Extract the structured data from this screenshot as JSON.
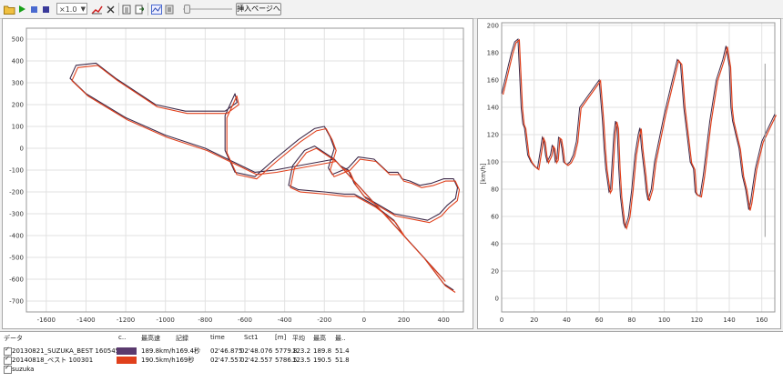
{
  "colors": {
    "run1": "#3c2848",
    "run2": "#e0401c"
  },
  "toolbar": {
    "icons": [
      "open-folder-icon",
      "play-icon",
      "pause-icon",
      "stop-icon",
      "chart-edit-icon",
      "close-icon",
      "clipboard-icon",
      "export-icon",
      "line-chart-icon",
      "stats-icon"
    ],
    "zoom": "×1.0",
    "insert_label": "挿入ページへ"
  },
  "map": {
    "x_ticks": [
      "-1600",
      "-1400",
      "-1200",
      "-1000",
      "-800",
      "-600",
      "-400",
      "-200",
      "0",
      "200",
      "400"
    ],
    "y_ticks": [
      "500",
      "400",
      "300",
      "200",
      "100",
      "0",
      "-100",
      "-200",
      "-300",
      "-400",
      "-500",
      "-600",
      "-700"
    ]
  },
  "speed": {
    "y_label": "[km/h]",
    "y_ticks": [
      "200",
      "180",
      "160",
      "140",
      "120",
      "100",
      "80",
      "60",
      "40",
      "20",
      "0"
    ],
    "x_ticks": [
      "0",
      "20",
      "40",
      "60",
      "80",
      "100",
      "120",
      "140",
      "160"
    ]
  },
  "table": {
    "headers": [
      "データ",
      "c..",
      "最高速",
      "記録",
      "time",
      "Sct1",
      "[m]",
      "平均",
      "最高",
      "最.."
    ],
    "rows": [
      {
        "name": "20130821_SUZUKA_BEST 160545",
        "max_speed": "189.8km/h",
        "record": "169.4秒",
        "time": "02'46.875",
        "sct1": "02'48.076",
        "m": "5779.8",
        "avg": "123.2",
        "max": "189.8",
        "min": "51.4",
        "has_color": true,
        "color": "#5a3a6e"
      },
      {
        "name": "20140818_ベスト 100301",
        "max_speed": "190.5km/h",
        "record": "169秒",
        "time": "02'47.557",
        "sct1": "02'42.557",
        "m": "5786.5",
        "avg": "123.5",
        "max": "190.5",
        "min": "51.8",
        "has_color": true,
        "color": "#e0401c"
      },
      {
        "name": "suzuka",
        "max_speed": "",
        "record": "",
        "time": "",
        "sct1": "",
        "m": "",
        "avg": "",
        "max": "",
        "min": "",
        "has_color": false,
        "color": ""
      }
    ]
  },
  "chart_data": [
    {
      "type": "line",
      "title": "",
      "xlabel": "",
      "ylabel": "",
      "xlim": [
        -1700,
        500
      ],
      "ylim": [
        -750,
        550
      ],
      "grid": true,
      "series": [
        {
          "x": [
            400,
            -150,
            -450,
            -550,
            -800,
            -1000,
            -1200,
            -1400,
            -1480,
            -1450,
            -1350,
            -1250,
            -1050,
            -900,
            -700,
            -640,
            -650,
            -700,
            -700,
            -650,
            -550,
            -450,
            -330,
            -250,
            -200,
            -170,
            -150,
            -180,
            -160,
            -80,
            -30,
            50,
            120,
            170,
            190,
            230,
            280,
            340,
            400,
            450,
            470,
            460,
            420,
            380,
            320,
            150,
            0,
            -50,
            -80,
            -120,
            -150,
            -250,
            -300,
            -360,
            -380,
            -330,
            -200,
            -100,
            -50,
            50,
            150,
            200,
            250,
            300,
            350,
            400,
            450
          ],
          "y": [
            -600,
            -50,
            -100,
            -110,
            0,
            60,
            140,
            250,
            320,
            380,
            390,
            320,
            200,
            170,
            170,
            210,
            250,
            150,
            -10,
            -110,
            -130,
            -50,
            40,
            90,
            100,
            50,
            0,
            -90,
            -120,
            -90,
            -40,
            -50,
            -110,
            -110,
            -140,
            -150,
            -170,
            -160,
            -140,
            -140,
            -180,
            -230,
            -260,
            -300,
            -330,
            -300,
            -220,
            -160,
            -100,
            -80,
            -50,
            10,
            -10,
            -80,
            -170,
            -190,
            -200,
            -210,
            -210,
            -260,
            -330,
            -400,
            -450,
            -500,
            -560,
            -620,
            -650
          ]
        }
      ]
    },
    {
      "type": "line",
      "title": "",
      "xlabel": "",
      "ylabel": "[km/h]",
      "xlim": [
        0,
        168
      ],
      "ylim": [
        -10,
        202
      ],
      "grid": true,
      "series": [
        {
          "values": [
            150,
            160,
            170,
            180,
            188,
            190,
            140,
            128,
            125,
            105,
            100,
            97,
            95,
            110,
            118,
            115,
            105,
            100,
            105,
            112,
            110,
            100,
            102,
            118,
            117,
            110,
            100,
            98,
            100,
            105,
            115,
            140,
            160,
            130,
            110,
            95,
            78,
            80,
            100,
            120,
            130,
            125,
            95,
            75,
            65,
            55,
            52,
            60,
            80,
            105,
            120,
            125,
            110,
            90,
            78,
            72,
            80,
            100,
            135,
            155,
            165,
            175,
            172,
            140,
            120,
            100,
            95,
            78,
            76,
            75,
            90,
            110,
            130,
            160,
            175,
            185,
            170,
            140,
            130,
            125,
            120,
            110,
            90,
            80,
            65,
            70,
            95,
            115,
            135
          ],
          "x": [
            0,
            2,
            4,
            6,
            8,
            10,
            12,
            13,
            14,
            16,
            18,
            20,
            22,
            24,
            25,
            26,
            27,
            28,
            30,
            31,
            32,
            33,
            34,
            35,
            36,
            37,
            38,
            40,
            42,
            44,
            46,
            48,
            60,
            62,
            63,
            64,
            66,
            67,
            68,
            69,
            70,
            71,
            72,
            73,
            74,
            75,
            76,
            78,
            80,
            82,
            84,
            85,
            86,
            88,
            89,
            90,
            92,
            94,
            100,
            104,
            106,
            108,
            110,
            112,
            114,
            116,
            118,
            119,
            120,
            122,
            124,
            126,
            128,
            132,
            136,
            138,
            140,
            141,
            142,
            143,
            144,
            146,
            148,
            150,
            152,
            153,
            156,
            160,
            168
          ]
        }
      ]
    }
  ]
}
